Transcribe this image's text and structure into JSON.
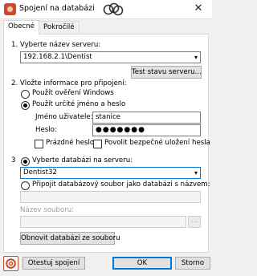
{
  "window": {
    "title": "Spojení na databázi",
    "close_glyph": "✕"
  },
  "tabs": [
    {
      "label": "Obecné",
      "active": true
    },
    {
      "label": "Pokročilé",
      "active": false
    }
  ],
  "server": {
    "step_label": "1. Vyberte název serveru:",
    "value": "192.168.2.1\\Dentist",
    "test_button": "Test stavu serveru..."
  },
  "login": {
    "step_label": "2. Vložte informace pro připojení:",
    "option_windows": "Použít ověření Windows",
    "option_password": "Použít určité jméno a heslo",
    "selected": "password",
    "username_label": "Jméno uživatele:",
    "username_value": "stanice",
    "password_label": "Heslo:",
    "password_mask": "●●●●●●●",
    "empty_password_label": "Prázdné heslo",
    "empty_password_checked": false,
    "save_password_label": "Povolit bezpečné uložení hesla",
    "save_password_checked": false
  },
  "database": {
    "step_number": "3",
    "option_server_db": "Vyberte databázi na serveru:",
    "db_value": "Dentist32",
    "option_attach_file": "Připojit databázový soubor jako databázi s názvem:",
    "attach_value": "",
    "file_name_label": "Název souboru:",
    "file_name_value": "",
    "browse_glyph": "...",
    "restore_button": "Obnovit databázi ze souboru"
  },
  "footer": {
    "test_button": "Otestuj spojení",
    "ok_button": "OK",
    "cancel_button": "Storno"
  },
  "colors": {
    "accent": "#0078d7",
    "icon": "#c94a2c"
  }
}
